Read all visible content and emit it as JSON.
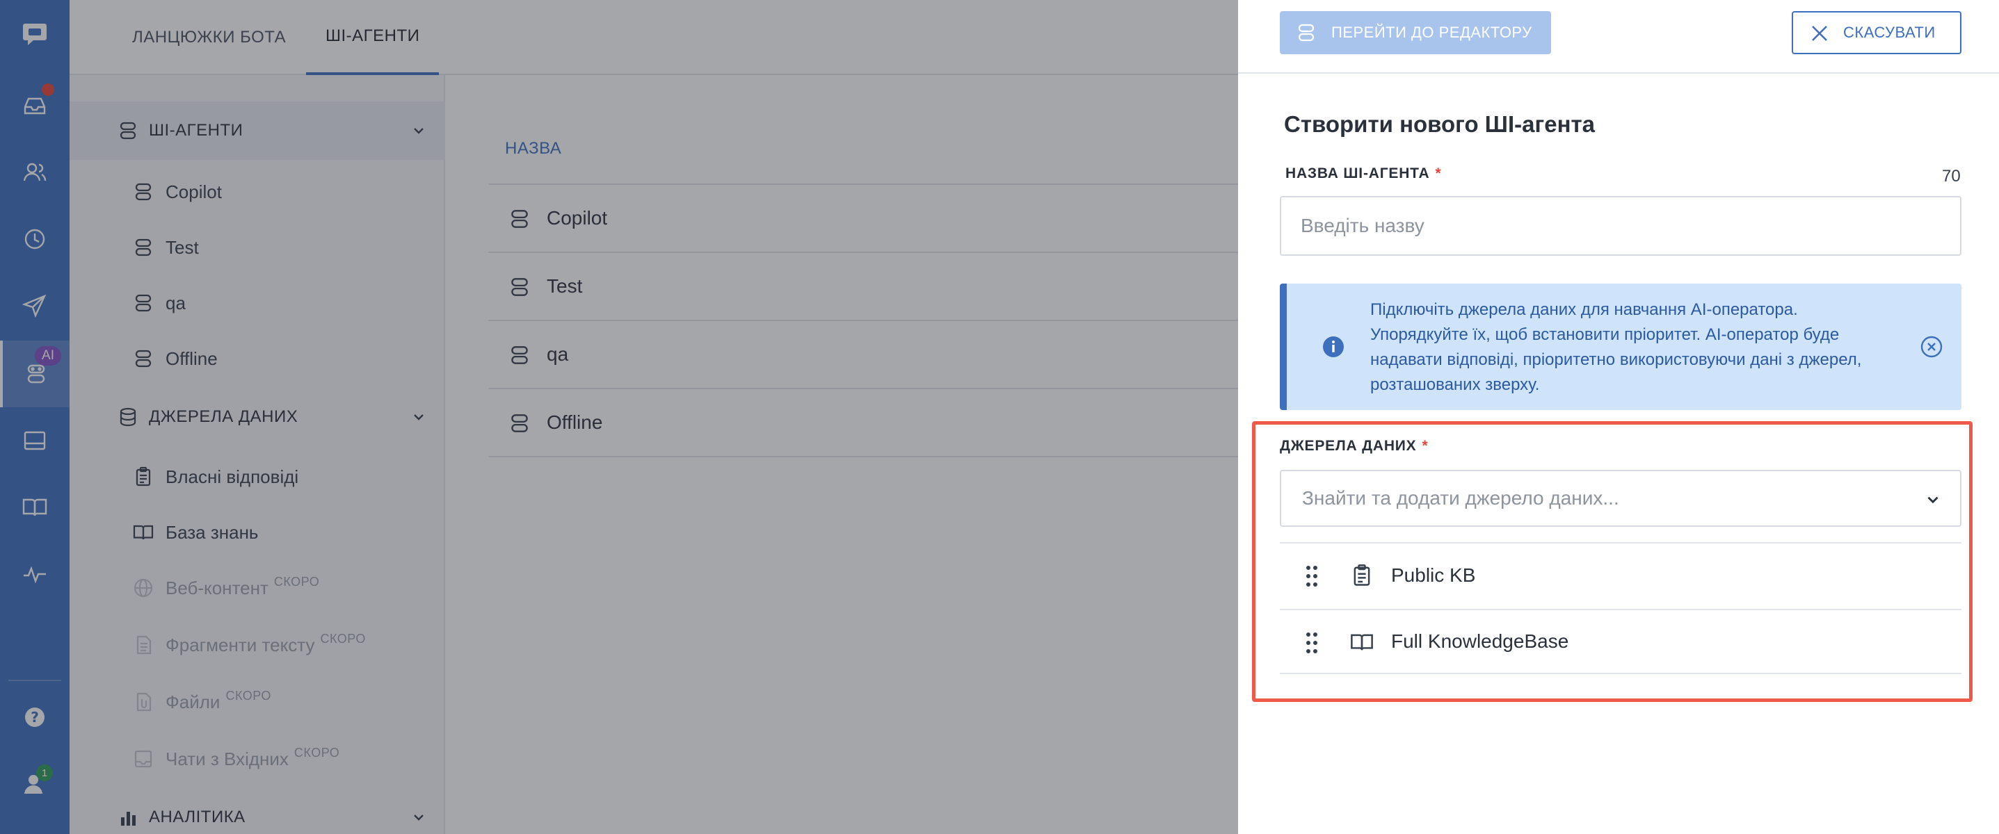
{
  "tabs": [
    {
      "label": "ЛАНЦЮЖКИ БОТА"
    },
    {
      "label": "ШІ-АГЕНТИ"
    }
  ],
  "rail": {
    "ai_badge": "AI",
    "notification_count": "1"
  },
  "sidebar": {
    "sections": [
      {
        "label": "ШІ-АГЕНТИ"
      },
      {
        "label": "ДЖЕРЕЛА ДАНИХ"
      },
      {
        "label": "АНАЛІТИКА"
      }
    ],
    "agents": [
      "Copilot",
      "Test",
      "qa",
      "Offline"
    ],
    "sources": [
      {
        "label": "Власні відповіді"
      },
      {
        "label": "База знань"
      },
      {
        "label": "Веб-контент",
        "badge": "СКОРО"
      },
      {
        "label": "Фрагменти тексту",
        "badge": "СКОРО"
      },
      {
        "label": "Файли",
        "badge": "СКОРО"
      },
      {
        "label": "Чати з Вхідних",
        "badge": "СКОРО"
      }
    ]
  },
  "main": {
    "column_header": "НАЗВА",
    "rows": [
      "Copilot",
      "Test",
      "qa",
      "Offline"
    ]
  },
  "drawer": {
    "editor_button": "ПЕРЕЙТИ ДО РЕДАКТОРУ",
    "cancel_button": "СКАСУВАТИ",
    "title": "Створити нового ШІ-агента",
    "name_label": "НАЗВА ШІ-АГЕНТА",
    "required_mark": "*",
    "name_counter": "70",
    "name_placeholder": "Введіть назву",
    "info_text": "Підключіть джерела даних для навчання AI-оператора. Упорядкуйте їх, щоб встановити пріоритет. AI-оператор буде надавати відповіді, пріоритетно використовуючи дані з джерел, розташованих зверху.",
    "sources_label": "ДЖЕРЕЛА ДАНИХ",
    "sources_placeholder": "Знайти та додати джерело даних...",
    "sources": [
      {
        "label": "Public KB",
        "icon": "clipboard-icon"
      },
      {
        "label": "Full KnowledgeBase",
        "icon": "book-icon"
      }
    ]
  },
  "colors": {
    "primary": "#3d6fbd",
    "highlight": "#ee5a4a",
    "info_bg": "#cfe3fb"
  }
}
